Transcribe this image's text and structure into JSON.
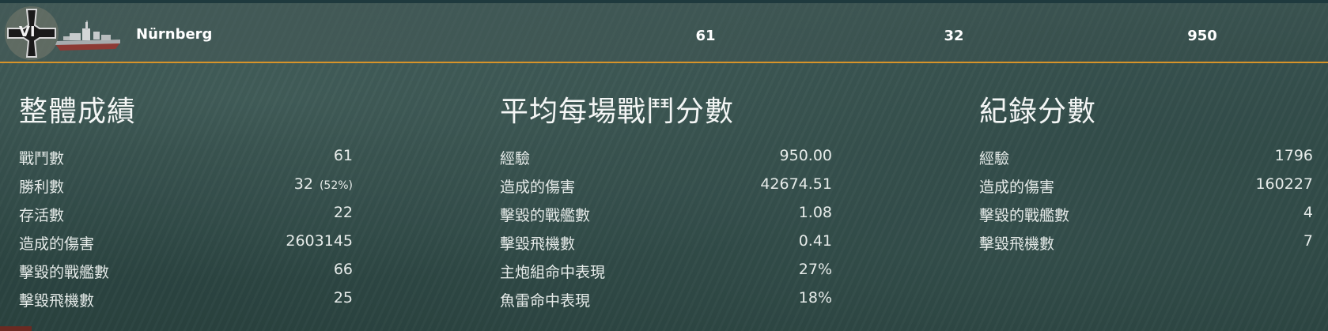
{
  "ship": {
    "tier": "VI",
    "name": "Nürnberg",
    "battles": "61",
    "victories": "32",
    "avg_xp": "950"
  },
  "colors": {
    "accent": "#d7942a",
    "background": "#2f4845"
  },
  "overall": {
    "title": "整體成績",
    "rows": [
      {
        "label": "戰鬥數",
        "value": "61",
        "pct": ""
      },
      {
        "label": "勝利數",
        "value": "32",
        "pct": "(52%)"
      },
      {
        "label": "存活數",
        "value": "22",
        "pct": ""
      },
      {
        "label": "造成的傷害",
        "value": "2603145",
        "pct": ""
      },
      {
        "label": "擊毀的戰艦數",
        "value": "66",
        "pct": ""
      },
      {
        "label": "擊毀飛機數",
        "value": "25",
        "pct": ""
      }
    ]
  },
  "average": {
    "title": "平均每場戰鬥分數",
    "rows": [
      {
        "label": "經驗",
        "value": "950.00"
      },
      {
        "label": "造成的傷害",
        "value": "42674.51"
      },
      {
        "label": "擊毀的戰艦數",
        "value": "1.08"
      },
      {
        "label": "擊毀飛機數",
        "value": "0.41"
      },
      {
        "label": "主炮組命中表現",
        "value": "27%"
      },
      {
        "label": "魚雷命中表現",
        "value": "18%"
      }
    ]
  },
  "records": {
    "title": "紀錄分數",
    "rows": [
      {
        "label": "經驗",
        "value": "1796"
      },
      {
        "label": "造成的傷害",
        "value": "160227"
      },
      {
        "label": "擊毀的戰艦數",
        "value": "4"
      },
      {
        "label": "擊毀飛機數",
        "value": "7"
      }
    ]
  },
  "icons": {
    "nation": "german-iron-cross-flag-icon",
    "ship": "cruiser-ship-icon"
  }
}
